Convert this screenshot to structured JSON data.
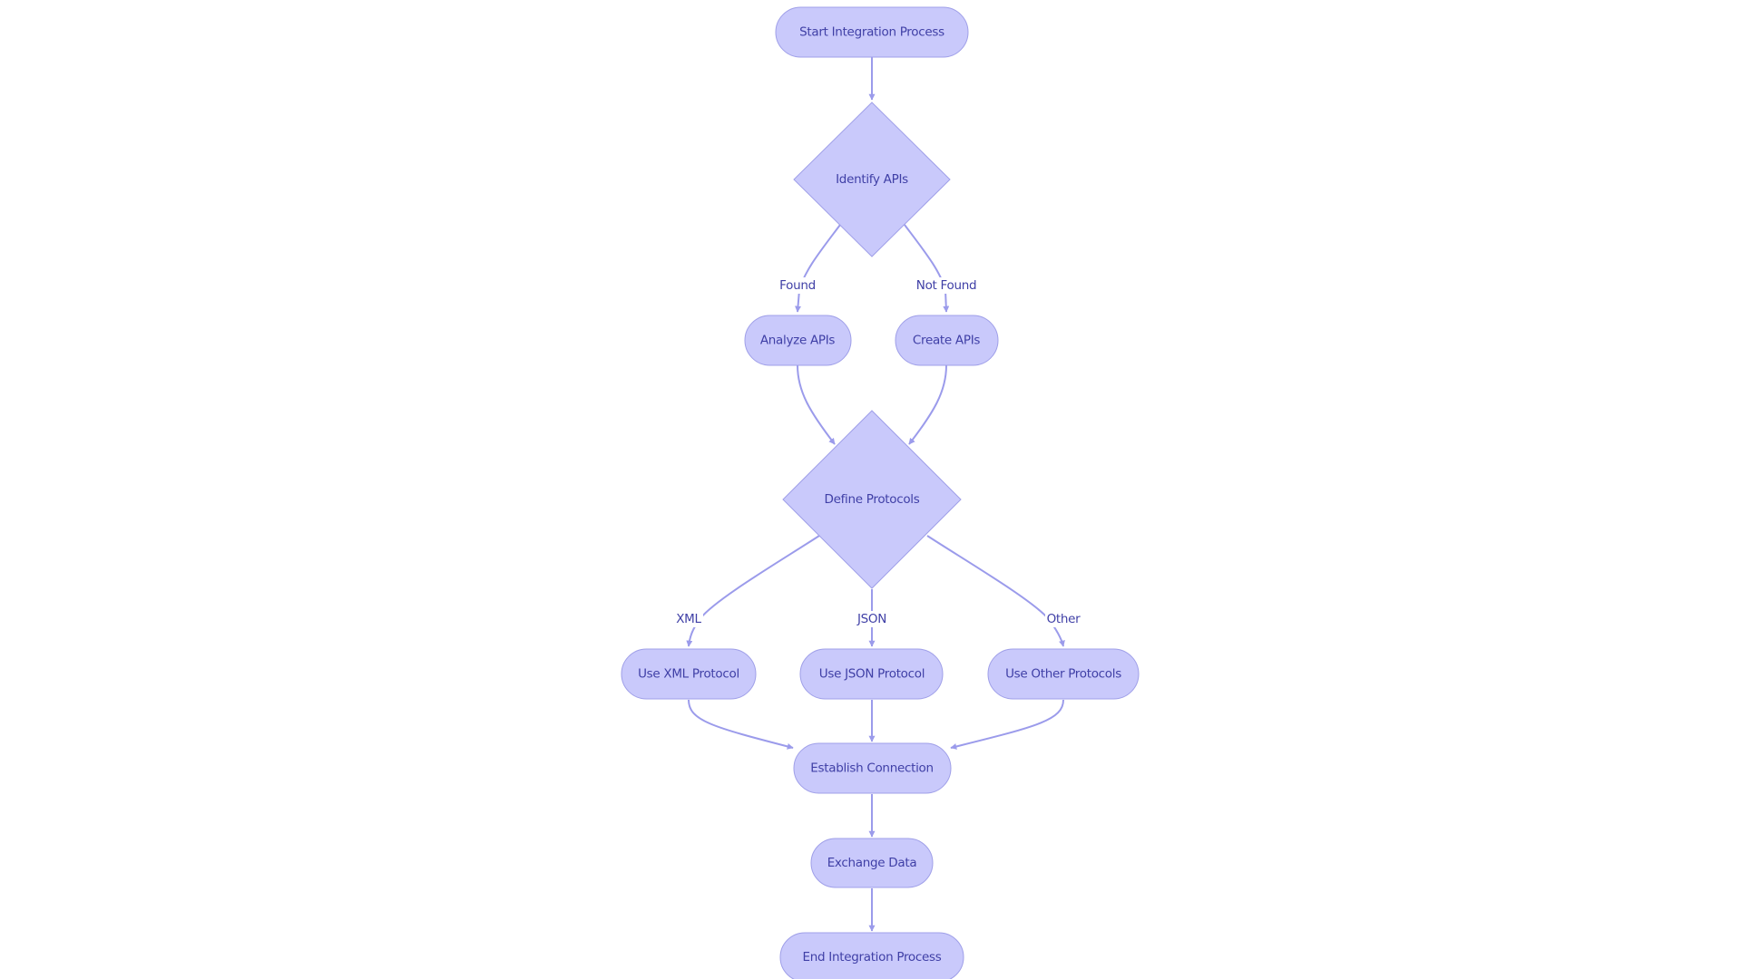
{
  "diagram": {
    "type": "flowchart",
    "colors": {
      "node_fill": "#c9c9fb",
      "node_stroke": "#9f9fe8",
      "edge": "#9b9beb",
      "text": "#3f3fa6",
      "background": "#ffffff"
    },
    "nodes": {
      "start": {
        "label": "Start Integration Process",
        "shape": "pill"
      },
      "identify": {
        "label": "Identify APIs",
        "shape": "diamond"
      },
      "analyze": {
        "label": "Analyze APIs",
        "shape": "pill"
      },
      "create": {
        "label": "Create APIs",
        "shape": "pill"
      },
      "define": {
        "label": "Define Protocols",
        "shape": "diamond"
      },
      "xml": {
        "label": "Use XML Protocol",
        "shape": "pill"
      },
      "json": {
        "label": "Use JSON Protocol",
        "shape": "pill"
      },
      "other": {
        "label": "Use Other Protocols",
        "shape": "pill"
      },
      "establish": {
        "label": "Establish Connection",
        "shape": "pill"
      },
      "exchange": {
        "label": "Exchange Data",
        "shape": "pill"
      },
      "end": {
        "label": "End Integration Process",
        "shape": "pill"
      }
    },
    "edges": [
      {
        "from": "start",
        "to": "identify",
        "label": ""
      },
      {
        "from": "identify",
        "to": "analyze",
        "label": "Found"
      },
      {
        "from": "identify",
        "to": "create",
        "label": "Not Found"
      },
      {
        "from": "analyze",
        "to": "define",
        "label": ""
      },
      {
        "from": "create",
        "to": "define",
        "label": ""
      },
      {
        "from": "define",
        "to": "xml",
        "label": "XML"
      },
      {
        "from": "define",
        "to": "json",
        "label": "JSON"
      },
      {
        "from": "define",
        "to": "other",
        "label": "Other"
      },
      {
        "from": "xml",
        "to": "establish",
        "label": ""
      },
      {
        "from": "json",
        "to": "establish",
        "label": ""
      },
      {
        "from": "other",
        "to": "establish",
        "label": ""
      },
      {
        "from": "establish",
        "to": "exchange",
        "label": ""
      },
      {
        "from": "exchange",
        "to": "end",
        "label": ""
      }
    ],
    "edge_labels": {
      "found": "Found",
      "not_found": "Not Found",
      "xml": "XML",
      "json": "JSON",
      "other": "Other"
    }
  }
}
